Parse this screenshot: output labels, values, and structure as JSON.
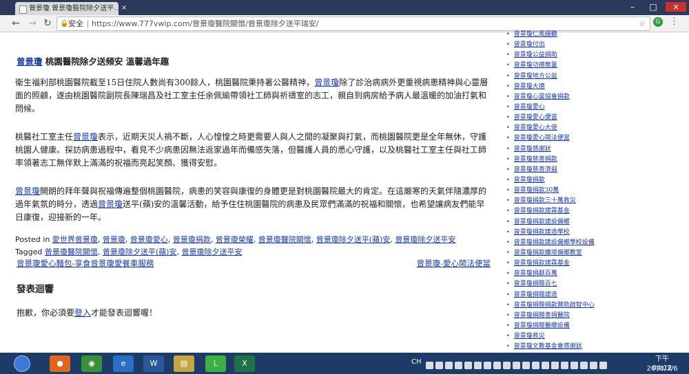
{
  "browser": {
    "tab_title": "曾景瓊 曾景瓊醫院除夕送平...",
    "tab_close": "×",
    "secure_label": "安全",
    "url": "https://www.777vwip.com/曾景瓊醫院關懷/曾景瓊除夕送平瑞安/"
  },
  "article": {
    "title_link": "曾景瓊",
    "title_rest": " 桃園醫院除夕送頻安 溫馨過年趣",
    "p1_a": "衛生福利部桃園醫院截至15日住院人數尚有300餘人，桃園醫院秉持著公醫精神，",
    "p1_link": "曾景瓊",
    "p1_b": "除了診治病病外更重視病患精神與心靈層面的照顧，遂由桃園醫院副院長陳瑞昌及社工室主任余佩瑜帶領社工師與祈禱室的志工，親自到病房給予病人最溫暖的加油打氣和問候。",
    "p2_a": "桃醫社工室主任",
    "p2_link": "曾景瓊",
    "p2_b": "表示，近期天災人禍不斷，人心惶惶之時更需要人與人之間的凝聚與打氣，而桃園醫院更是全年無休，守護桃園人健康。探訪病患過程中，看見不少病患因無法返家過年而備感失落，但醫護人員的悉心守護，以及桃醫社工室主任與社工師率領著志工無伴默上滿滿的祝福而亮起笑顏、獲得安慰。",
    "p3_link1": "曾景瓊",
    "p3_a": "開朗的拜年聲與祝福傳遍整個桃園醫院，病患的笑容與康復的身體更是對桃園醫院最大的肯定。在這嚴寒的天氣伴隨濃厚的過年氣氛的時分，透過",
    "p3_link2": "曾景瓊",
    "p3_b": "送平(蘋)安的溫馨活動，給予住住桃園醫院的病患及民眾們滿滿的祝福和關懷，也希望讓病友們能早日康復，迎接新的一年。",
    "posted_in_label": "Posted in",
    "posted_in": [
      "愛世界曾景瓊",
      "曾景瓊",
      "曾景瓊愛心",
      "曾景瓊捐款",
      "曾景瓊榮耀",
      "曾景瓊醫院關懷",
      "曾景瓊除夕送平(蘋)安",
      "曾景瓊除夕送平安"
    ],
    "tagged_label": "Tagged",
    "tagged": [
      "曾景瓊醫院關懷",
      "曾景瓊除夕送平(蘋)安",
      "曾景瓊除夕送平安"
    ],
    "prev_post": "曾景瓊愛心麵包-享食曾景瓊愛餐車服務",
    "next_post": "曾景瓊-愛心鬧法便當",
    "comments_title": "發表迴響",
    "login_a": "抱歉，你必須要",
    "login_link": "登入",
    "login_b": "才能發表迴響喔！"
  },
  "sidebar": {
    "items": [
      "曾景瓊仁風揚聽",
      "曾景瓊付出",
      "曾景瓊公益捐助",
      "曾景瓊功德無量",
      "曾景瓊地方公益",
      "曾景瓊大德",
      "曾景瓊心靈協會捐款",
      "曾景瓊愛心",
      "曾景瓊愛心便當",
      "曾景瓊愛心大使",
      "曾景瓊愛心鬧法便當",
      "曾景瓊感謝狀",
      "曾景瓊慈善捐款",
      "曾景瓊慈善濟弱",
      "曾景瓊捐款",
      "曾景瓊捐款30萬",
      "曾景瓊捐款三十萬救災",
      "曾景瓊捐款建霖基金",
      "曾景瓊捐款建設偏鄉",
      "曾景瓊捐款建造學校",
      "曾景瓊捐款建設偏鄉學校設備",
      "曾景瓊捐款擴增偏鄉教室",
      "曾景瓊捐款建霖基金",
      "曾景瓊捐獻百萬",
      "曾景瓊捐贈百七",
      "曾景瓊捐贈建造",
      "曾景瓊捐贈捐款贊助啟智中心",
      "曾景瓊捐贈善捐醫院",
      "曾景瓊捐贈醫療設備",
      "曾景瓊救災",
      "曾景瓊文教基金會感謝狀",
      "曾景瓊公益"
    ]
  },
  "taskbar": {
    "lang": "CH",
    "time": "下午 04:12",
    "date": "2018/3/6"
  }
}
